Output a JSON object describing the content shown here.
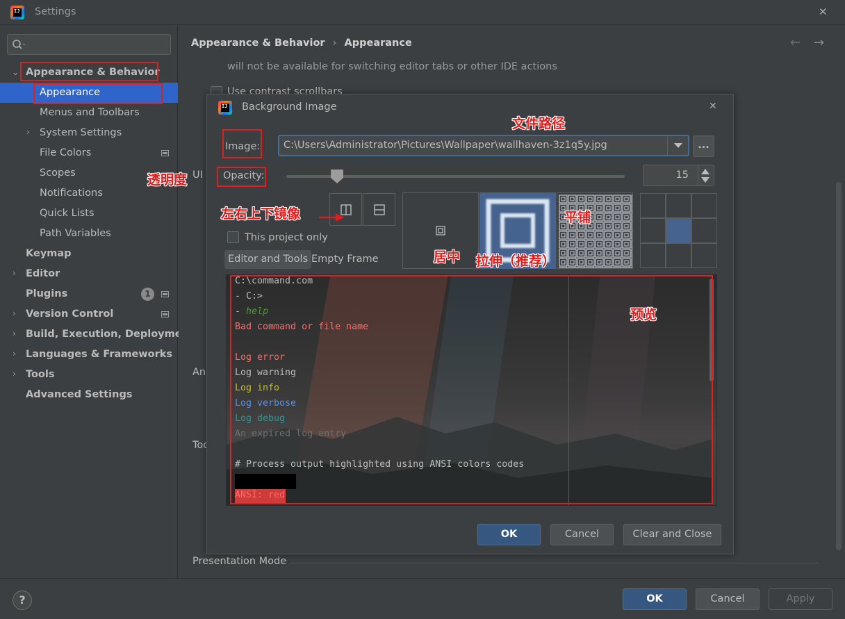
{
  "window": {
    "title": "Settings",
    "close_glyph": "✕"
  },
  "search": {
    "placeholder": ""
  },
  "sidebar": {
    "items": [
      {
        "label": "Appearance & Behavior",
        "badge": ""
      },
      {
        "label": "Appearance",
        "badge": ""
      },
      {
        "label": "Menus and Toolbars",
        "badge": ""
      },
      {
        "label": "System Settings",
        "badge": ""
      },
      {
        "label": "File Colors",
        "badge": ""
      },
      {
        "label": "Scopes",
        "badge": ""
      },
      {
        "label": "Notifications",
        "badge": ""
      },
      {
        "label": "Quick Lists",
        "badge": ""
      },
      {
        "label": "Path Variables",
        "badge": ""
      },
      {
        "label": "Keymap",
        "badge": ""
      },
      {
        "label": "Editor",
        "badge": ""
      },
      {
        "label": "Plugins",
        "badge": "1"
      },
      {
        "label": "Version Control",
        "badge": ""
      },
      {
        "label": "Build, Execution, Deployment",
        "badge": ""
      },
      {
        "label": "Languages & Frameworks",
        "badge": ""
      },
      {
        "label": "Tools",
        "badge": ""
      },
      {
        "label": "Advanced Settings",
        "badge": ""
      }
    ]
  },
  "main": {
    "breadcrumb": [
      "Appearance & Behavior",
      "Appearance"
    ],
    "breadcrumb_separator": "›",
    "nav_back": "←",
    "nav_forward": "→",
    "hint_text": "will not be available for switching editor tabs or other IDE actions",
    "contrast_scrollbars_label": "Use contrast scrollbars",
    "partial_ui": "UI",
    "partial_an": "An",
    "partial_to": "Too",
    "presentation_mode": "Presentation Mode"
  },
  "dialog": {
    "title": "Background Image",
    "close_glyph": "✕",
    "image_label": "Image:",
    "image_path": "C:\\Users\\Administrator\\Pictures\\Wallpaper\\wallhaven-3z1q5y.jpg",
    "browse_label": "...",
    "opacity_label": "Opacity:",
    "opacity_value": "15",
    "opacity_fraction": 0.15,
    "this_project_only": "This project only",
    "tabs": [
      "Editor and Tools",
      "Empty Frame"
    ],
    "preview_lines": [
      {
        "text": "C:\\command.com",
        "color": "#bbbbbb",
        "italic": false
      },
      {
        "text": "- C:>",
        "color": "#bbbbbb",
        "italic": false
      },
      {
        "text": "- help",
        "color": "#bbbbbb",
        "italic": false,
        "accent": "help",
        "accent_color": "#4e9a35"
      },
      {
        "text": "Bad command or file name",
        "color": "#ff6b68",
        "italic": false
      },
      {
        "text": "",
        "color": "#bbbbbb",
        "italic": false
      },
      {
        "text": "Log error",
        "color": "#ff6b68",
        "italic": false
      },
      {
        "text": "Log warning",
        "color": "#bbbbbb",
        "italic": false
      },
      {
        "text": "Log info",
        "color": "#c7c21f",
        "italic": false
      },
      {
        "text": "Log verbose",
        "color": "#5394ec",
        "italic": false
      },
      {
        "text": "Log debug",
        "color": "#299999",
        "italic": false
      },
      {
        "text": "An expired log entry",
        "color": "#6f6f6f",
        "italic": false
      },
      {
        "text": "",
        "color": "#bbbbbb",
        "italic": false
      },
      {
        "text": "# Process output highlighted using ANSI colors codes",
        "color": "#bbbbbb",
        "italic": false
      },
      {
        "text": "",
        "color": "#bbbbbb",
        "italic": false
      },
      {
        "text": "ANSI: red",
        "color": "#ff6b68",
        "italic": false
      }
    ],
    "buttons": {
      "ok": "OK",
      "cancel": "Cancel",
      "clear_close": "Clear and Close"
    }
  },
  "footer": {
    "help": "?",
    "ok": "OK",
    "cancel": "Cancel",
    "apply": "Apply"
  },
  "annotations": {
    "file_path": "文件路径",
    "opacity": "透明度",
    "mirror": "左右上下镜像",
    "tile": "平铺",
    "center": "居中",
    "stretch": "拉伸（推荐）",
    "preview": "预览"
  },
  "colors": {
    "annotation_red": "#e02020",
    "selection_blue": "#2f65ca",
    "primary_button": "#365880"
  }
}
